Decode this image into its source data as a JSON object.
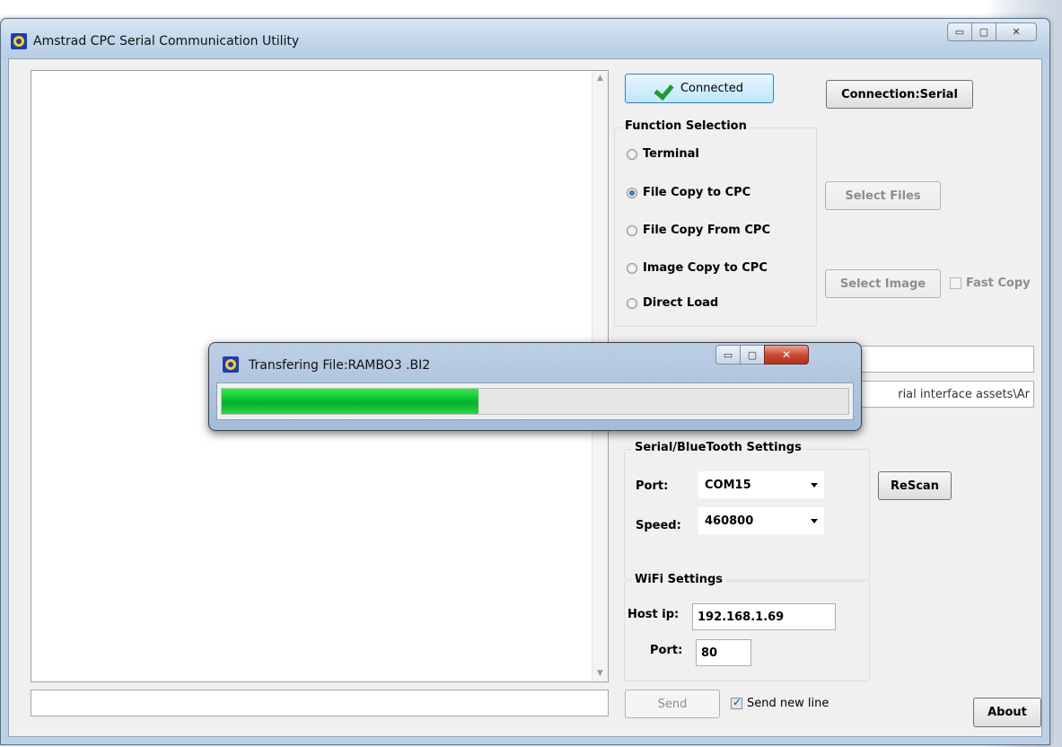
{
  "window": {
    "title": "Amstrad CPC Serial Communication Utility",
    "icon": "amstrad-cpc-icon"
  },
  "toolbar": {
    "connected_label": "Connected",
    "connection_label": "Connection:Serial"
  },
  "function_selection": {
    "title": "Function Selection",
    "options": [
      {
        "label": "Terminal",
        "checked": false
      },
      {
        "label": "File Copy to CPC",
        "checked": true
      },
      {
        "label": "File Copy From CPC",
        "checked": false
      },
      {
        "label": "Image Copy to CPC",
        "checked": false
      },
      {
        "label": "Direct Load",
        "checked": false
      }
    ],
    "select_files_label": "Select  Files",
    "select_image_label": "Select Image",
    "fast_copy_label": "Fast Copy"
  },
  "path_field": {
    "visible_text": "rial interface assets\\Ar"
  },
  "serial_settings": {
    "title": "Serial/BlueTooth Settings",
    "port_label": "Port:",
    "port_value": "COM15",
    "speed_label": "Speed:",
    "speed_value": "460800",
    "rescan_label": "ReScan"
  },
  "wifi_settings": {
    "title": "WiFi Settings",
    "host_label": "Host ip:",
    "host_value": "192.168.1.69",
    "port_label": "Port:",
    "port_value": "80"
  },
  "bottom": {
    "send_label": "Send",
    "send_new_line_label": "Send new line",
    "send_new_line_checked": true,
    "about_label": "About",
    "command_value": ""
  },
  "progress_dialog": {
    "title": "Transfering File:RAMBO3  .BI2",
    "progress": 0.41,
    "bar_color": "#06c12e"
  }
}
